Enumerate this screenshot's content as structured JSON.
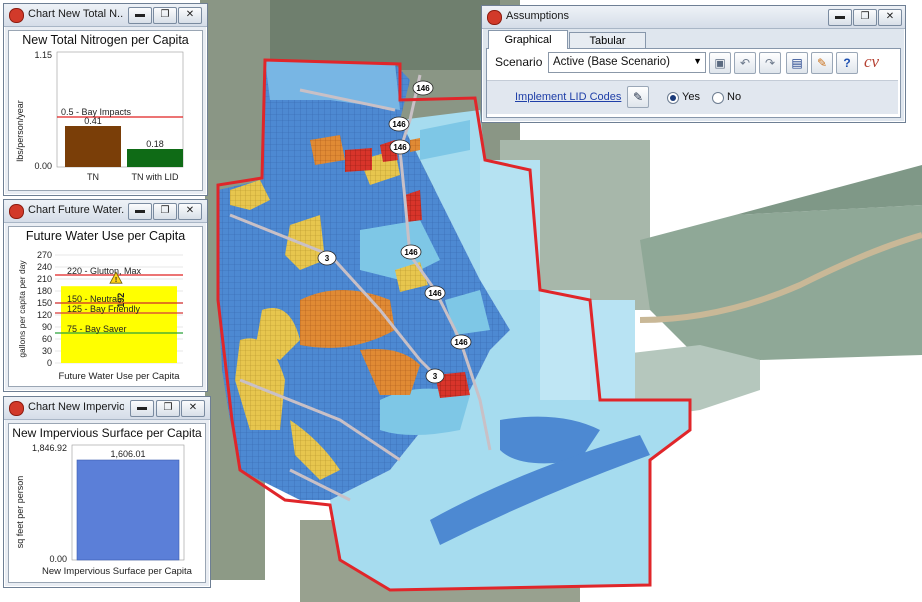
{
  "colors": {
    "water_light": "#a6dcef",
    "water_mid": "#7ec7e6",
    "grid_blue": "#3f7cc9",
    "boundary": "#e0262a",
    "low_density": "#e6c24a",
    "mid_density": "#e07a2c",
    "high_density": "#d8342a",
    "bar_brown": "#7a3e08",
    "bar_green": "#0f6b16",
    "bar_blue": "#5b7fd8",
    "highlight_yellow": "#ffff00"
  },
  "map": {
    "road_labels": [
      "146",
      "146",
      "146",
      "146",
      "146",
      "146",
      "3",
      "3"
    ]
  },
  "nitrogen_window": {
    "title": "Chart New Total N...",
    "chart_title": "New Total Nitrogen per Capita",
    "ylabel": "lbs/person/year",
    "y_max_label": "1.15",
    "y_min_label": "0.00",
    "threshold_label": "0.5 - Bay Impacts"
  },
  "water_window": {
    "title": "Chart Future Water...",
    "chart_title": "Future Water Use per Capita",
    "ylabel": "gallons per capita per day",
    "xlabel": "Future Water Use per Capita",
    "ticks": [
      "270",
      "240",
      "210",
      "180",
      "150",
      "120",
      "90",
      "60",
      "30",
      "0"
    ],
    "thresholds": [
      "220 - Glutton, Max",
      "150 - Neutral",
      "125 - Bay Friendly",
      "75 - Bay Saver"
    ],
    "bar_value_label": "192",
    "warning_icon": "warning-triangle-icon"
  },
  "impervious_window": {
    "title": "Chart New Impervio...",
    "chart_title": "New Impervious Surface per Capita",
    "ylabel": "sq feet per person",
    "xlabel": "New Impervious Surface per Capita",
    "y_max_label": "1,846.92",
    "y_min_label": "0.00"
  },
  "assumptions_window": {
    "title": "Assumptions",
    "tabs": [
      "Graphical",
      "Tabular"
    ],
    "scenario_label": "Scenario",
    "scenario_value": "Active (Base Scenario)",
    "lid_link": "Implement LID Codes",
    "radio_yes": "Yes",
    "radio_no": "No",
    "toolbar_icons": [
      "save-icon",
      "undo-icon",
      "redo-icon",
      "notes-icon",
      "edit-icon",
      "help-icon"
    ]
  },
  "window_buttons": {
    "minimize": "▬",
    "restore": "❐",
    "close": "✕"
  },
  "chart_data": [
    {
      "type": "bar",
      "title": "New Total Nitrogen per Capita",
      "ylabel": "lbs/person/year",
      "categories": [
        "TN",
        "TN with LID"
      ],
      "values": [
        0.41,
        0.18
      ],
      "value_labels": [
        "0.41",
        "0.18"
      ],
      "ylim": [
        0,
        1.15
      ],
      "reference_lines": [
        {
          "value": 0.5,
          "label": "0.5 - Bay Impacts"
        }
      ]
    },
    {
      "type": "bar",
      "title": "Future Water Use per Capita",
      "ylabel": "gallons per capita per day",
      "categories": [
        "Future Water Use per Capita"
      ],
      "values": [
        192
      ],
      "ylim": [
        0,
        270
      ],
      "reference_lines": [
        {
          "value": 220,
          "label": "220 - Glutton, Max"
        },
        {
          "value": 150,
          "label": "150 - Neutral"
        },
        {
          "value": 125,
          "label": "125 - Bay Friendly"
        },
        {
          "value": 75,
          "label": "75 - Bay Saver"
        }
      ]
    },
    {
      "type": "bar",
      "title": "New Impervious Surface per Capita",
      "ylabel": "sq feet per person",
      "categories": [
        "New Impervious Surface per Capita"
      ],
      "values": [
        1606.01
      ],
      "value_labels": [
        "1,606.01"
      ],
      "ylim": [
        0,
        1846.92
      ]
    }
  ]
}
